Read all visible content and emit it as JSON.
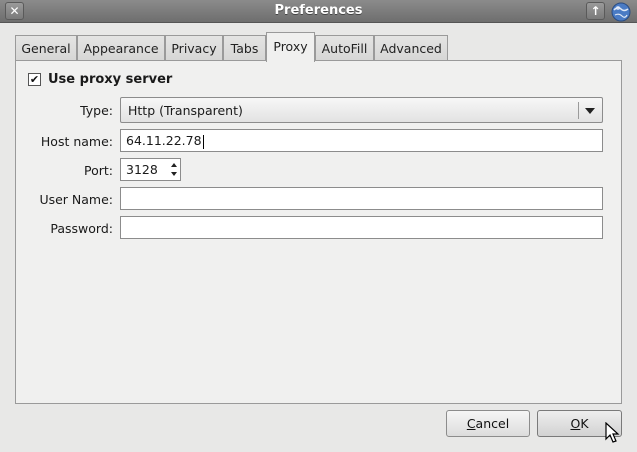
{
  "window": {
    "title": "Preferences",
    "close_icon": "close-icon",
    "up_icon": "arrow-up-icon",
    "app_icon": "globe-icon"
  },
  "tabs": [
    {
      "label": "General"
    },
    {
      "label": "Appearance"
    },
    {
      "label": "Privacy"
    },
    {
      "label": "Tabs"
    },
    {
      "label": "Proxy",
      "active": true
    },
    {
      "label": "AutoFill"
    },
    {
      "label": "Advanced"
    }
  ],
  "proxy": {
    "use_proxy_label": "Use proxy server",
    "use_proxy_checked": true,
    "type_label": "Type:",
    "type_value": "Http (Transparent)",
    "host_label": "Host name:",
    "host_value": "64.11.22.78",
    "port_label": "Port:",
    "port_value": "3128",
    "user_label": "User Name:",
    "user_value": "",
    "password_label": "Password:",
    "password_value": ""
  },
  "buttons": {
    "cancel_label": "Cancel",
    "ok_label": "OK"
  }
}
